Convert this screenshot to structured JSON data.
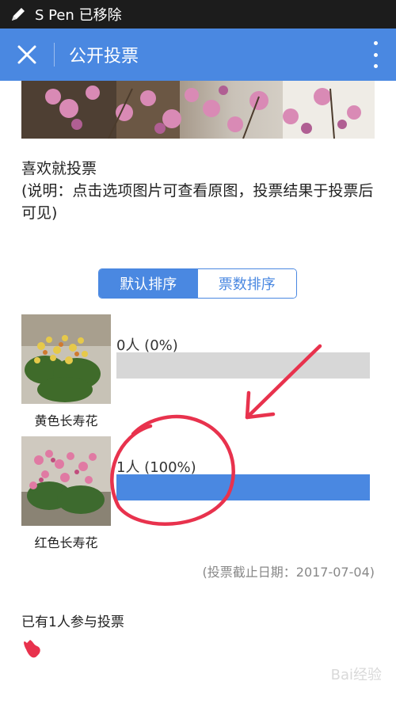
{
  "status_bar": {
    "text": "S Pen 已移除",
    "icon": "pen-icon"
  },
  "app_bar": {
    "title": "公开投票",
    "close_icon": "close-icon",
    "more_icon": "more-vertical-icon",
    "color": "#4a88e1"
  },
  "intro": {
    "title": "喜欢就投票",
    "note": "(说明：点击选项图片可查看原图，投票结果于投票后可见)"
  },
  "sort": {
    "options": [
      "默认排序",
      "票数排序"
    ],
    "selected": "默认排序"
  },
  "options": [
    {
      "name": "黄色长寿花",
      "votes_label": "0人 (0%)",
      "percent": 0
    },
    {
      "name": "红色长寿花",
      "votes_label": "1人 (100%)",
      "percent": 100
    }
  ],
  "deadline": "(投票截止日期：2017-07-04)",
  "participants": "已有1人参与投票",
  "watermark": "Bai经验",
  "colors": {
    "accent": "#4a88e1",
    "bar_empty": "#d7d7d7",
    "annotation": "#e8324d"
  }
}
